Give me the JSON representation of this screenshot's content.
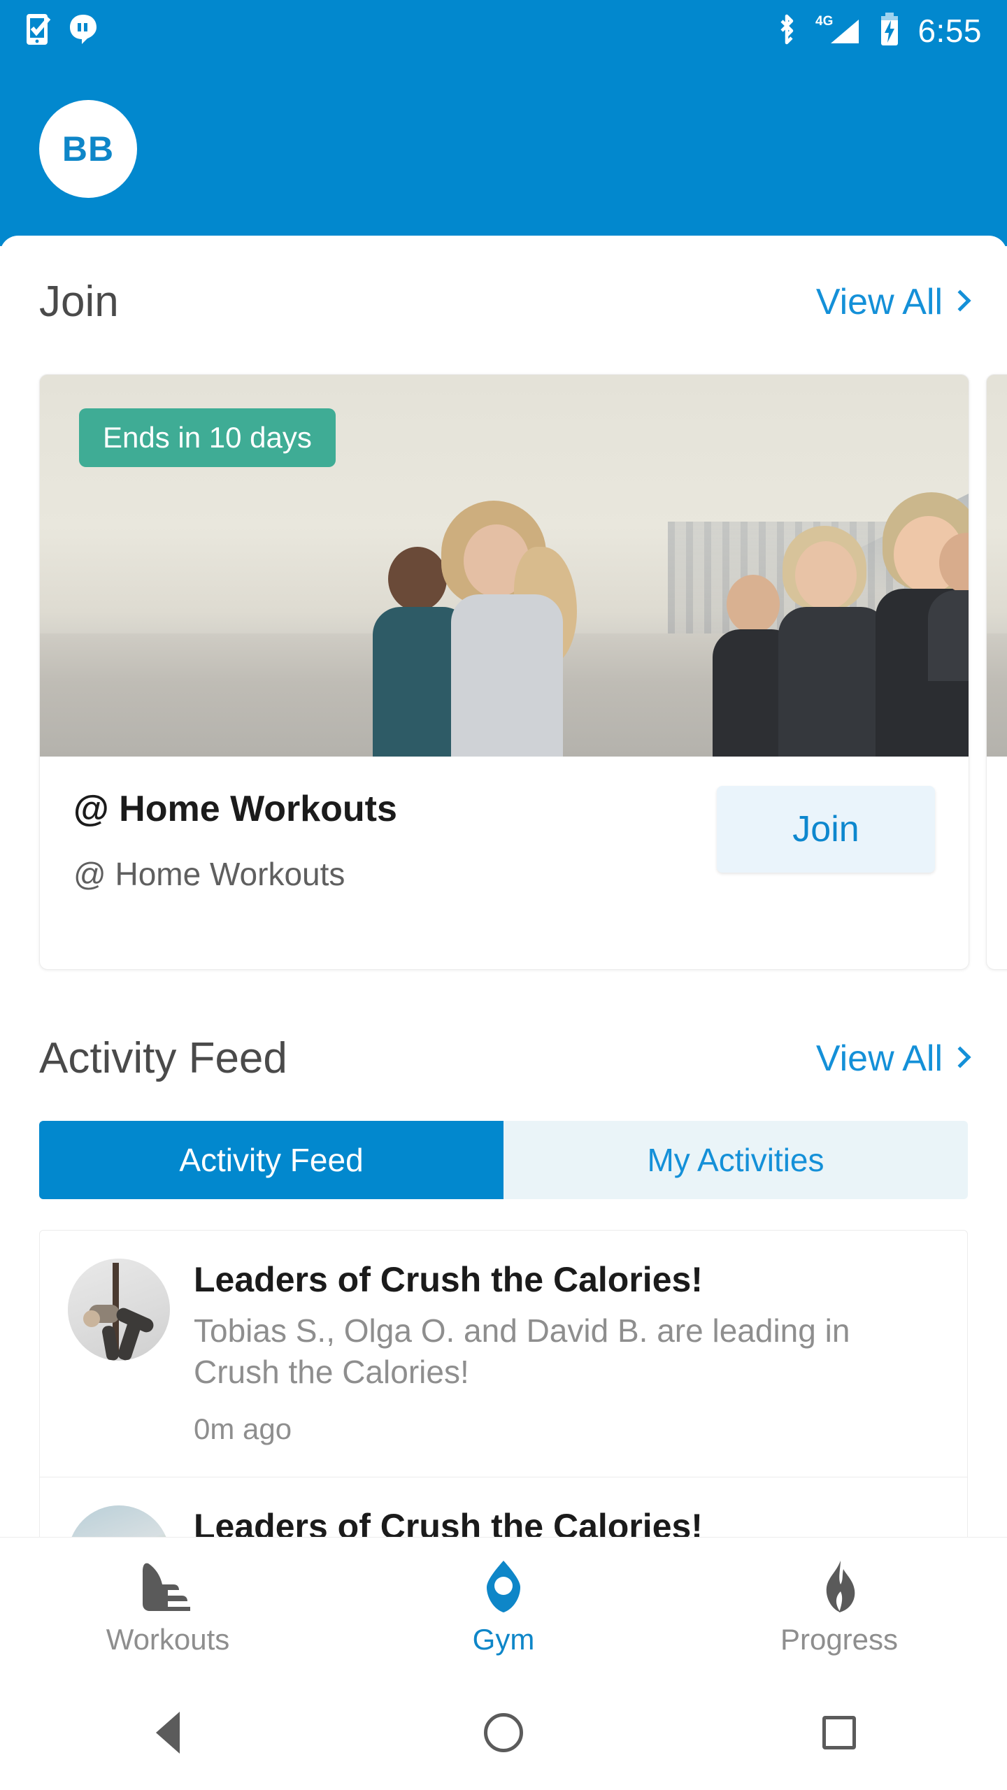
{
  "status_bar": {
    "icons_left": [
      "phone-check-icon",
      "hangouts-quote-icon"
    ],
    "icons_right": [
      "bluetooth-icon",
      "signal-4g-icon",
      "battery-charging-icon"
    ],
    "network_label": "4G",
    "time": "6:55"
  },
  "header": {
    "avatar_initials": "BB",
    "background_color": "#0288ce"
  },
  "join_section": {
    "title": "Join",
    "view_all": "View All",
    "cards": [
      {
        "badge": "Ends in 10 days",
        "title": "@ Home Workouts",
        "subtitle": "@ Home Workouts",
        "action_label": "Join",
        "image_alt": "group-running-beach-photo"
      },
      {
        "image_alt": "runner-photo-peek"
      }
    ]
  },
  "activity_section": {
    "title": "Activity Feed",
    "view_all": "View All",
    "tabs": [
      {
        "label": "Activity Feed",
        "active": true
      },
      {
        "label": "My Activities",
        "active": false
      }
    ],
    "items": [
      {
        "title": "Leaders of Crush the Calories!",
        "description": "Tobias S., Olga O. and David B. are leading in Crush the Calories!",
        "time": "0m ago",
        "avatar_alt": "yoga-pose-photo"
      },
      {
        "title": "Leaders of Crush the Calories!",
        "description": "",
        "time": "",
        "avatar_alt": "outdoor-photo"
      }
    ]
  },
  "bottom_nav": {
    "items": [
      {
        "label": "Workouts",
        "icon": "shoe-icon",
        "active": false
      },
      {
        "label": "Gym",
        "icon": "gym-diamond-icon",
        "active": true
      },
      {
        "label": "Progress",
        "icon": "flame-icon",
        "active": false
      }
    ],
    "active_color": "#0e86c8",
    "inactive_color": "#8e8e8e"
  },
  "system_nav": {
    "back": "back-button",
    "home": "home-button",
    "recents": "recents-button"
  },
  "colors": {
    "primary": "#0288ce",
    "link": "#1490d8",
    "badge_green": "#3fac95",
    "join_button_bg": "#eaf4fb"
  }
}
